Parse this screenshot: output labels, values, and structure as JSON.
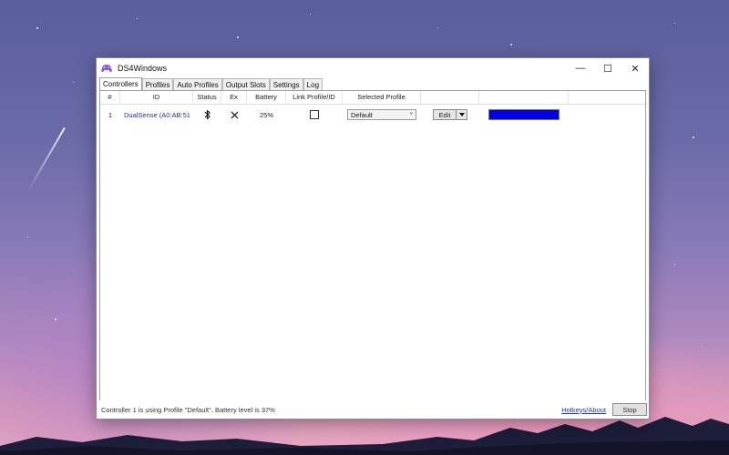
{
  "window": {
    "title": "DS4Windows",
    "minimize_glyph": "—",
    "maximize_glyph": "☐",
    "close_glyph": "✕"
  },
  "tabs": [
    {
      "label": "Controllers",
      "active": true
    },
    {
      "label": "Profiles",
      "active": false
    },
    {
      "label": "Auto Profiles",
      "active": false
    },
    {
      "label": "Output Slots",
      "active": false
    },
    {
      "label": "Settings",
      "active": false
    },
    {
      "label": "Log",
      "active": false
    }
  ],
  "table": {
    "headers": {
      "num": "#",
      "id": "ID",
      "status": "Status",
      "ex": "Ex",
      "battery": "Battery",
      "link": "Link Profile/ID",
      "profile": "Selected Profile"
    },
    "rows": [
      {
        "num": "1",
        "id": "DualSense (A0:AB:51",
        "status_icon": "bluetooth-icon",
        "ex_icon": "close-icon",
        "battery": "25%",
        "link_checked": false,
        "selected_profile": "Default",
        "edit_label": "Edit",
        "light_color": "#0000e0"
      }
    ]
  },
  "status_bar": {
    "message": "Controller 1 is using Profile \"Default\". Battery level is 37%",
    "hotkeys_link": "Hotkeys/About",
    "stop_label": "Stop"
  }
}
